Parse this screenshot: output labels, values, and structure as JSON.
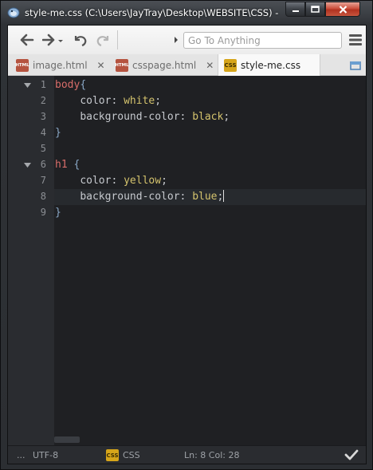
{
  "window": {
    "title": "style-me.css (C:\\Users\\JayTray\\Desktop\\WEBSITE\\CSS) - Ko"
  },
  "toolbar": {
    "back_icon": "back-arrow-icon",
    "forward_icon": "forward-arrow-icon",
    "undo_icon": "undo-icon",
    "redo_icon": "redo-icon",
    "goto_placeholder": "Go To Anything",
    "menu_icon": "hamburger-menu-icon"
  },
  "tabs": [
    {
      "label": "image.html",
      "badge": "HTML",
      "active": false
    },
    {
      "label": "csspage.html",
      "badge": "HTML",
      "active": false
    },
    {
      "label": "style-me.css",
      "badge": "CSS",
      "active": true
    }
  ],
  "editor": {
    "current_line": 8,
    "lines": [
      {
        "num": "1",
        "fold": true
      },
      {
        "num": "2"
      },
      {
        "num": "3"
      },
      {
        "num": "4"
      },
      {
        "num": "5"
      },
      {
        "num": "6",
        "fold": true
      },
      {
        "num": "7"
      },
      {
        "num": "8"
      },
      {
        "num": "9"
      }
    ],
    "code": {
      "l1_selector": "body",
      "l1_brace": "{",
      "l2_prop": "color",
      "l2_colon": ": ",
      "l2_val": "white",
      "l2_semi": ";",
      "l3_prop": "background-color",
      "l3_colon": ": ",
      "l3_val": "black",
      "l3_semi": ";",
      "l4_brace": "}",
      "l6_selector": "h1",
      "l6_brace": " {",
      "l7_prop": "color",
      "l7_colon": ": ",
      "l7_val": "yellow",
      "l7_semi": ";",
      "l8_prop": "background-color",
      "l8_colon": ": ",
      "l8_val": "blue",
      "l8_semi": ";",
      "l9_brace": "}"
    }
  },
  "statusbar": {
    "ellipsis": "...",
    "encoding": "UTF-8",
    "language_badge": "CSS",
    "language": "CSS",
    "position": "Ln: 8 Col: 28"
  },
  "colors": {
    "selector": "#d86d6a",
    "brace": "#8aa8c7",
    "value": "#d4c36d",
    "editor_bg": "#1f2023"
  }
}
